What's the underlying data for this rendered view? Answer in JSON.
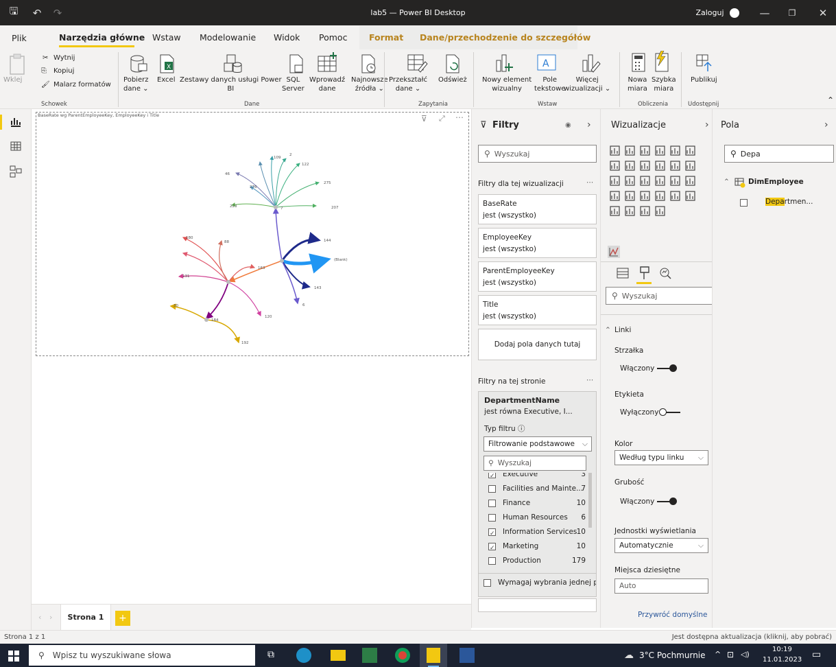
{
  "window": {
    "title": "lab5 — Power BI Desktop",
    "signin": "Zaloguj"
  },
  "menu": {
    "tabs": [
      "Plik",
      "Narzędzia główne",
      "Wstaw",
      "Modelowanie",
      "Widok",
      "Pomoc",
      "Format",
      "Dane/przechodzenie do szczegółów"
    ],
    "active": "Narzędzia główne"
  },
  "ribbon": {
    "clipboard": {
      "paste": "Wklej",
      "cut": "Wytnij",
      "copy": "Kopiuj",
      "format_painter": "Malarz formatów",
      "group": "Schowek"
    },
    "data": {
      "get_data": [
        "Pobierz",
        "dane ⌄"
      ],
      "excel": "Excel",
      "datasets": [
        "Zestawy danych usługi Power",
        "BI"
      ],
      "sql": [
        "SQL",
        "Server"
      ],
      "enter": [
        "Wprowadź",
        "dane"
      ],
      "recent": [
        "Najnowsze",
        "źródła ⌄"
      ],
      "group": "Dane"
    },
    "queries": {
      "transform": [
        "Przekształć",
        "dane ⌄"
      ],
      "refresh": "Odśwież",
      "group": "Zapytania"
    },
    "insert": {
      "new_visual": [
        "Nowy element",
        "wizualny"
      ],
      "textbox": [
        "Pole",
        "tekstowe"
      ],
      "more_visuals": [
        "Więcej",
        "wizualizacji ⌄"
      ],
      "group": "Wstaw"
    },
    "calculations": {
      "new_measure": [
        "Nowa",
        "miara"
      ],
      "quick_measure": [
        "Szybka",
        "miara"
      ],
      "group": "Obliczenia"
    },
    "share": {
      "publish": "Publikuj",
      "group": "Udostępnij"
    }
  },
  "visual": {
    "header": "BaseRate wg ParentEmployeeKey, EmployeeKey i Title",
    "node_labels": {
      "a": "109",
      "b": "2",
      "c": "122",
      "d": "275",
      "e": "207",
      "f": "223",
      "g": "46",
      "h": "276",
      "i": "7",
      "j": "180",
      "k": "88",
      "l": "163",
      "m": "144",
      "n": "(Blank)",
      "o": "143",
      "p": "131",
      "q": "6",
      "r": "120",
      "s": "30",
      "t": "184",
      "u": "192"
    }
  },
  "filters": {
    "title": "Filtry",
    "search_placeholder": "Wyszukaj",
    "visual_section": "Filtry dla tej wizualizacji",
    "cards": [
      {
        "field": "BaseRate",
        "state": "jest (wszystko)"
      },
      {
        "field": "EmployeeKey",
        "state": "jest (wszystko)"
      },
      {
        "field": "ParentEmployeeKey",
        "state": "jest (wszystko)"
      },
      {
        "field": "Title",
        "state": "jest (wszystko)"
      }
    ],
    "add_fields": "Dodaj pola danych tutaj",
    "page_section": "Filtry na tej stronie",
    "page_card": {
      "field": "DepartmentName",
      "state": "jest równa Executive, I...",
      "filter_type_label": "Typ filtru ⓘ",
      "filter_type": "Filtrowanie podstawowe",
      "search_placeholder": "Wyszukaj",
      "items": [
        {
          "name": "Executive",
          "count": "3",
          "checked": true
        },
        {
          "name": "Facilities and Mainte...",
          "count": "7",
          "checked": false
        },
        {
          "name": "Finance",
          "count": "10",
          "checked": false
        },
        {
          "name": "Human Resources",
          "count": "6",
          "checked": false
        },
        {
          "name": "Information Services",
          "count": "10",
          "checked": true
        },
        {
          "name": "Marketing",
          "count": "10",
          "checked": true
        },
        {
          "name": "Production",
          "count": "179",
          "checked": false
        }
      ],
      "require_single": "Wymagaj wybrania jednej pc"
    }
  },
  "viz": {
    "title": "Wizualizacje",
    "search_placeholder": "Wyszukaj",
    "section": "Linki",
    "arrow_label": "Strzałka",
    "arrow_state": "Włączony",
    "label_label": "Etykieta",
    "label_state": "Wyłączony",
    "color_label": "Kolor",
    "color_value": "Według typu linku",
    "thickness_label": "Grubość",
    "thickness_state": "Włączony",
    "units_label": "Jednostki wyświetlania",
    "units_value": "Automatycznie",
    "decimals_label": "Miejsca dziesiętne",
    "decimals_value": "Auto",
    "reset": "Przywróć domyślne"
  },
  "fields": {
    "title": "Pola",
    "search_value": "Depa",
    "table": "DimEmployee",
    "field_prefix": "Depa",
    "field_suffix": "rtmen..."
  },
  "pages": {
    "tab": "Strona 1",
    "status": "Strona 1 z 1",
    "update": "Jest dostępna aktualizacja (kliknij, aby pobrać)"
  },
  "taskbar": {
    "search_placeholder": "Wpisz tu wyszukiwane słowa",
    "weather": "3°C  Pochmurnie",
    "time": "10:19",
    "date": "11.01.2023"
  },
  "colors": {
    "accent": "#f2c811",
    "title_bg": "#252423",
    "taskbar_bg": "#1b2231"
  }
}
